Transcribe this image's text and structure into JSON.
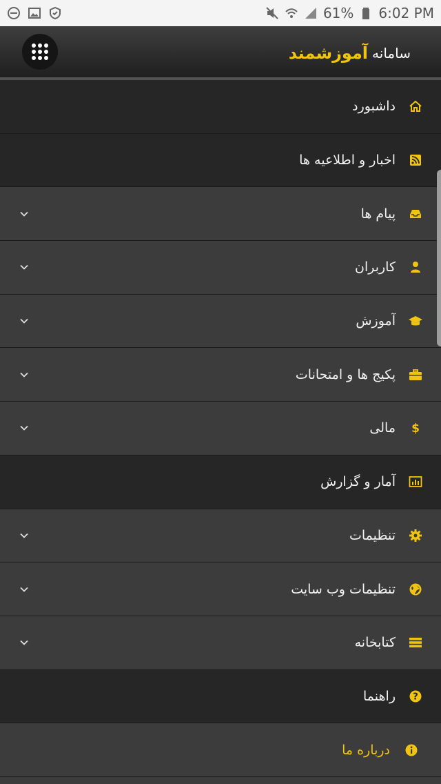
{
  "status_bar": {
    "battery": "61%",
    "time": "6:02 PM",
    "left_icons": [
      "dnd-icon",
      "image-icon",
      "shield-icon"
    ],
    "right_icons": [
      "mute-icon",
      "wifi-icon",
      "signal-icon",
      "battery-icon"
    ]
  },
  "header": {
    "prefix": "سامانه",
    "name": "آموزشمند"
  },
  "nav": {
    "items": [
      {
        "label": "داشبورد",
        "icon": "home-icon",
        "expandable": false,
        "shade": "dark"
      },
      {
        "label": "اخبار و اطلاعیه ها",
        "icon": "rss-icon",
        "expandable": false,
        "shade": "dark"
      },
      {
        "label": "پیام ها",
        "icon": "inbox-icon",
        "expandable": true,
        "shade": "light"
      },
      {
        "label": "کاربران",
        "icon": "user-icon",
        "expandable": true,
        "shade": "light"
      },
      {
        "label": "آموزش",
        "icon": "graduation-cap-icon",
        "expandable": true,
        "shade": "light"
      },
      {
        "label": "پکیج ها و امتحانات",
        "icon": "briefcase-icon",
        "expandable": true,
        "shade": "light"
      },
      {
        "label": "مالی",
        "icon": "dollar-icon",
        "expandable": true,
        "shade": "light"
      },
      {
        "label": "آمار و گزارش",
        "icon": "bar-chart-icon",
        "expandable": false,
        "shade": "dark"
      },
      {
        "label": "تنظیمات",
        "icon": "gear-icon",
        "expandable": true,
        "shade": "light"
      },
      {
        "label": "تنظیمات وب سایت",
        "icon": "globe-icon",
        "expandable": true,
        "shade": "light"
      },
      {
        "label": "کتابخانه",
        "icon": "library-icon",
        "expandable": true,
        "shade": "light"
      },
      {
        "label": "راهنما",
        "icon": "question-icon",
        "expandable": false,
        "shade": "dark"
      },
      {
        "label": "درباره ما",
        "icon": "info-icon",
        "expandable": false,
        "shade": "light",
        "highlight": true
      }
    ]
  },
  "colors": {
    "accent": "#f1c40f",
    "item_dark": "#262626",
    "item_light": "#3c3c3c",
    "divider": "#1b1b1b",
    "status_bg": "#f4f4f4"
  }
}
